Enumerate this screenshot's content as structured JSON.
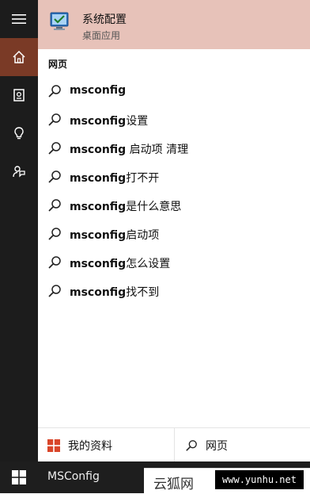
{
  "best_match": {
    "title": "系统配置",
    "subtitle": "桌面应用",
    "icon": "system-config-icon"
  },
  "section_label": "网页",
  "suggestions": [
    {
      "bold": "msconfig",
      "rest": ""
    },
    {
      "bold": "msconfig",
      "rest": "设置"
    },
    {
      "bold": "msconfig",
      "rest": " 启动项 清理"
    },
    {
      "bold": "msconfig",
      "rest": "打不开"
    },
    {
      "bold": "msconfig",
      "rest": "是什么意思"
    },
    {
      "bold": "msconfig",
      "rest": "启动项"
    },
    {
      "bold": "msconfig",
      "rest": "怎么设置"
    },
    {
      "bold": "msconfig",
      "rest": "找不到"
    }
  ],
  "bottom": {
    "my_stuff_label": "我的资料",
    "web_label": "网页"
  },
  "taskbar": {
    "query": "MSConfig"
  },
  "watermark": {
    "brand": "云狐网",
    "url": "www.yunhu.net"
  },
  "colors": {
    "rail": "#1c1c1c",
    "rail_active": "#7a3a26",
    "best_match_bg": "#e7c2b9",
    "windows_logo": "#d9462a"
  }
}
